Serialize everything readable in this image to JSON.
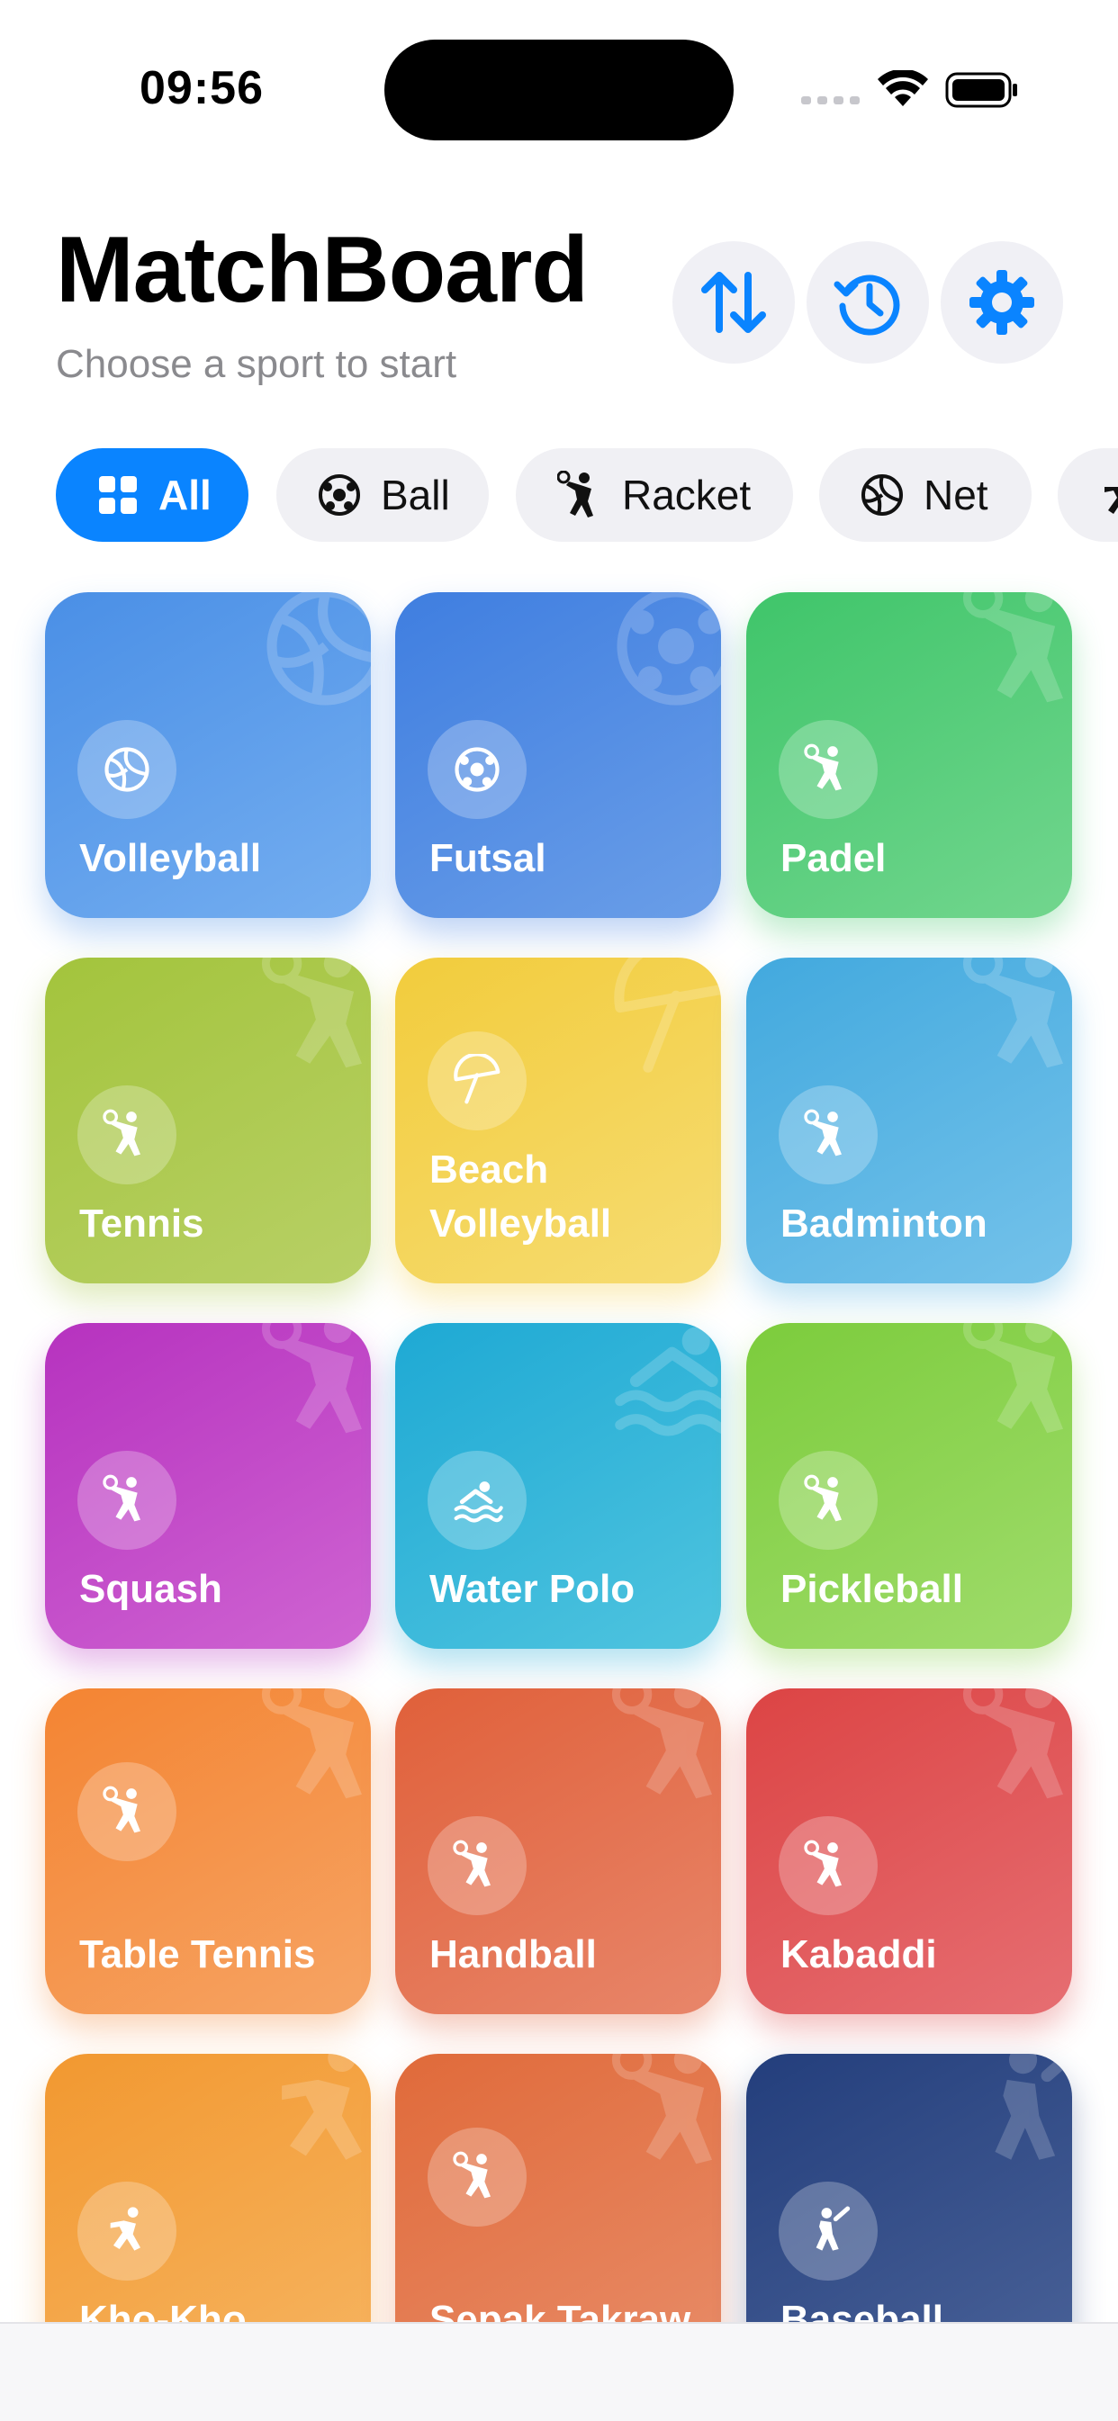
{
  "status": {
    "time": "09:56"
  },
  "header": {
    "title": "MatchBoard",
    "subtitle": "Choose a sport to start",
    "buttons": [
      "sort-icon",
      "history-icon",
      "gear-icon"
    ]
  },
  "filters": [
    {
      "label": "All",
      "icon": "grid-icon",
      "active": true
    },
    {
      "label": "Ball",
      "icon": "soccer-ball-icon"
    },
    {
      "label": "Racket",
      "icon": "racket-player-icon"
    },
    {
      "label": "Net",
      "icon": "volleyball-icon"
    }
  ],
  "sports": [
    {
      "name": "Volleyball",
      "icon": "volleyball-icon",
      "from": "#4a8fe6",
      "to": "#74aef0"
    },
    {
      "name": "Futsal",
      "icon": "soccer-ball-icon",
      "from": "#3f7ee0",
      "to": "#6a9ee8"
    },
    {
      "name": "Padel",
      "icon": "player-icon",
      "from": "#3fc56a",
      "to": "#72d68e"
    },
    {
      "name": "Tennis",
      "icon": "player-icon",
      "from": "#a3c43c",
      "to": "#b8d066"
    },
    {
      "name": "Beach Volleyball",
      "icon": "umbrella-icon",
      "from": "#f2cc3c",
      "to": "#f6dc72"
    },
    {
      "name": "Badminton",
      "icon": "player-icon",
      "from": "#42a9de",
      "to": "#74c2ea"
    },
    {
      "name": "Squash",
      "icon": "player-icon",
      "from": "#b632bf",
      "to": "#cf64d2"
    },
    {
      "name": "Water Polo",
      "icon": "swimmer-icon",
      "from": "#1ea9d4",
      "to": "#4fc4df"
    },
    {
      "name": "Pickleball",
      "icon": "player-icon",
      "from": "#7ccc3c",
      "to": "#a0dc6c"
    },
    {
      "name": "Table Tennis",
      "icon": "player-icon",
      "from": "#f48432",
      "to": "#f6a464"
    },
    {
      "name": "Handball",
      "icon": "player-icon",
      "from": "#e0603a",
      "to": "#e8866a"
    },
    {
      "name": "Kabaddi",
      "icon": "player-icon",
      "from": "#dc4444",
      "to": "#e66e72"
    },
    {
      "name": "Kho-Kho",
      "icon": "runner-icon",
      "from": "#f29830",
      "to": "#f6b460"
    },
    {
      "name": "Sepak Takraw",
      "icon": "player-icon",
      "from": "#e06a3a",
      "to": "#e88c68"
    },
    {
      "name": "Baseball",
      "icon": "batter-icon",
      "from": "#233e7c",
      "to": "#4a6298"
    }
  ],
  "colors": {
    "accent": "#0a84ff"
  }
}
